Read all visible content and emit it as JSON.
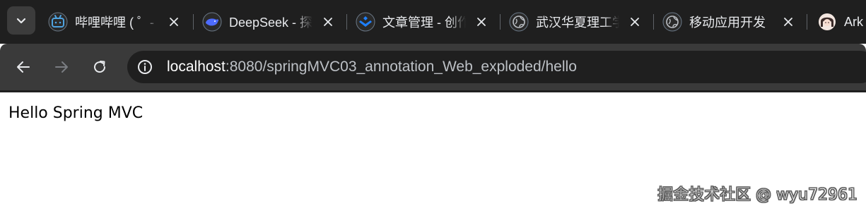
{
  "tabs": [
    {
      "title": "哔哩哔哩 ( ゜- ゜)つロ 干杯~",
      "icon": "bilibili-icon",
      "active": false
    },
    {
      "title": "DeepSeek - 探索未至之境",
      "icon": "deepseek-whale-icon",
      "active": false
    },
    {
      "title": "文章管理 - 创作者中心",
      "icon": "juejin-icon",
      "active": false
    },
    {
      "title": "武汉华夏理工学院",
      "icon": "globe-icon",
      "active": false
    },
    {
      "title": "移动应用开发",
      "icon": "globe-icon",
      "active": false
    },
    {
      "title": "Ark",
      "icon": "avatar-icon",
      "active": false
    }
  ],
  "address_bar": {
    "host": "localhost",
    "rest": ":8080/springMVC03_annotation_Web_exploded/hello"
  },
  "page": {
    "body_text": "Hello Spring MVC"
  },
  "watermark": "掘金技术社区 @ wyu72961",
  "colors": {
    "tabstrip_bg": "#1f1f1f",
    "toolbar_bg": "#3a3a3a",
    "omnibox_bg": "#1f1f1f",
    "text_light": "#e8eaed"
  }
}
